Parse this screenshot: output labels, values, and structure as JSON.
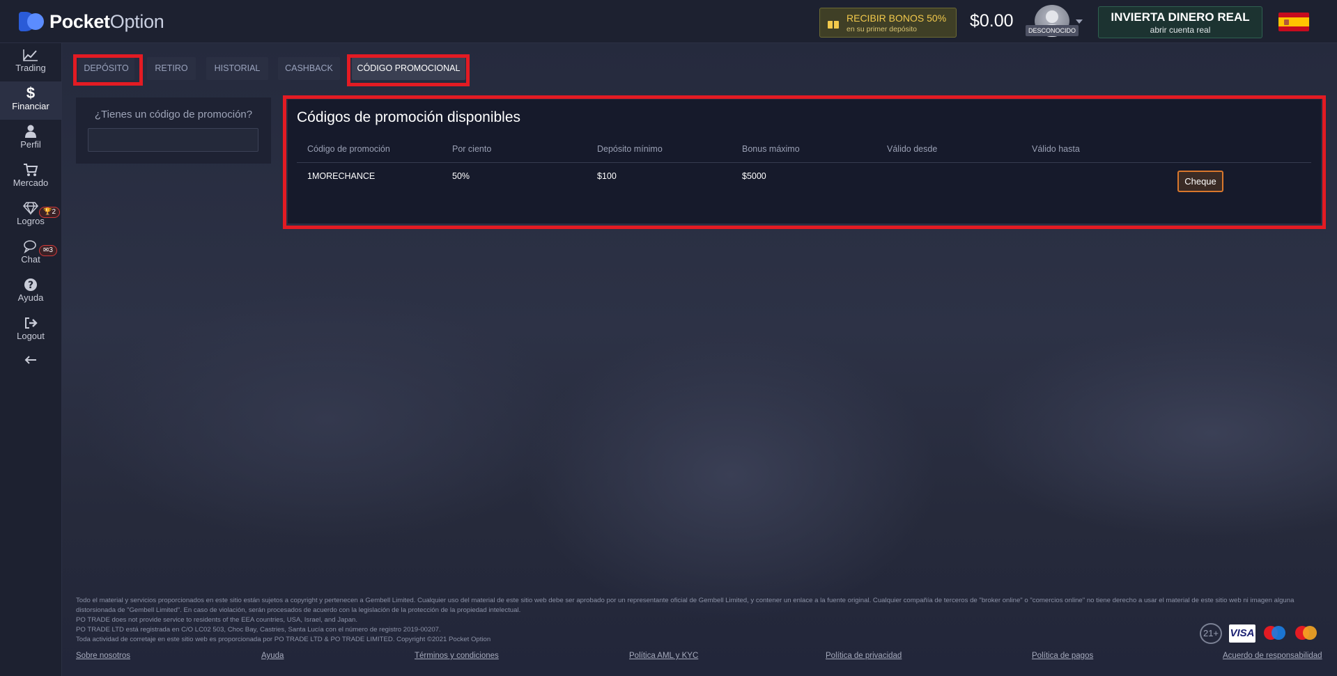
{
  "header": {
    "brand_bold": "Pocket",
    "brand_light": "Option",
    "bonus_title": "RECIBIR BONOS 50%",
    "bonus_subtitle": "en su primer depósito",
    "balance": "$0.00",
    "user_status": "DESCONOCIDO",
    "real_title": "INVIERTA DINERO REAL",
    "real_subtitle": "abrir cuenta real",
    "flag": "spain-flag-icon"
  },
  "sidebar": {
    "items": [
      {
        "label": "Trading",
        "icon": "chart-line-icon"
      },
      {
        "label": "Financiar",
        "icon": "dollar-icon"
      },
      {
        "label": "Perfil",
        "icon": "user-icon"
      },
      {
        "label": "Mercado",
        "icon": "cart-icon"
      },
      {
        "label": "Logros",
        "icon": "diamond-icon",
        "badge": "2"
      },
      {
        "label": "Chat",
        "icon": "chat-icon",
        "badge": "3"
      },
      {
        "label": "Ayuda",
        "icon": "question-icon"
      },
      {
        "label": "Logout",
        "icon": "logout-icon"
      }
    ]
  },
  "tabs": [
    "DEPÓSITO",
    "RETIRO",
    "HISTORIAL",
    "CASHBACK",
    "CÓDIGO PROMOCIONAL"
  ],
  "promo_form": {
    "question": "¿Tienes un código de promoción?",
    "input_value": ""
  },
  "promo_panel": {
    "title": "Códigos de promoción disponibles",
    "columns": [
      "Código de promoción",
      "Por ciento",
      "Depósito mínimo",
      "Bonus máximo",
      "Válido desde",
      "Válido hasta"
    ],
    "rows": [
      {
        "code": "1MORECHANCE",
        "percent": "50%",
        "min_deposit": "$100",
        "max_bonus": "$5000",
        "valid_from": "",
        "valid_to": ""
      }
    ],
    "check_label": "Cheque"
  },
  "footer": {
    "lines": [
      "Todo el material y servicios proporcionados en este sitio están sujetos a copyright y pertenecen a Gembell Limited. Cualquier uso del material de este sitio web debe ser aprobado por un representante oficial de Gembell Limited, y contener un enlace a la fuente original. Cualquier compañía de terceros de \"broker online\" o \"comercios online\" no tiene derecho a usar el material de este sitio web ni imagen alguna distorsionada de \"Gembell Limited\". En caso de violación, serán procesados de acuerdo con la legislación de la protección de la propiedad intelectual.",
      "PO TRADE does not provide service to residents of the EEA countries, USA, Israel, and Japan.",
      "PO TRADE LTD está registrada en C/O LC02 503, Choc Bay, Castries, Santa Lucía con el número de registro 2019-00207.",
      "Toda actividad de corretaje en este sitio web es proporcionada por PO TRADE LTD & PO TRADE LIMITED. Copyright ©2021 Pocket Option"
    ],
    "links": [
      "Sobre nosotros",
      "Ayuda",
      "Términos y condiciones",
      "Política AML y KYC",
      "Política de privacidad",
      "Política de pagos",
      "Acuerdo de responsabilidad"
    ],
    "age_badge": "21+",
    "visa": "VISA"
  }
}
